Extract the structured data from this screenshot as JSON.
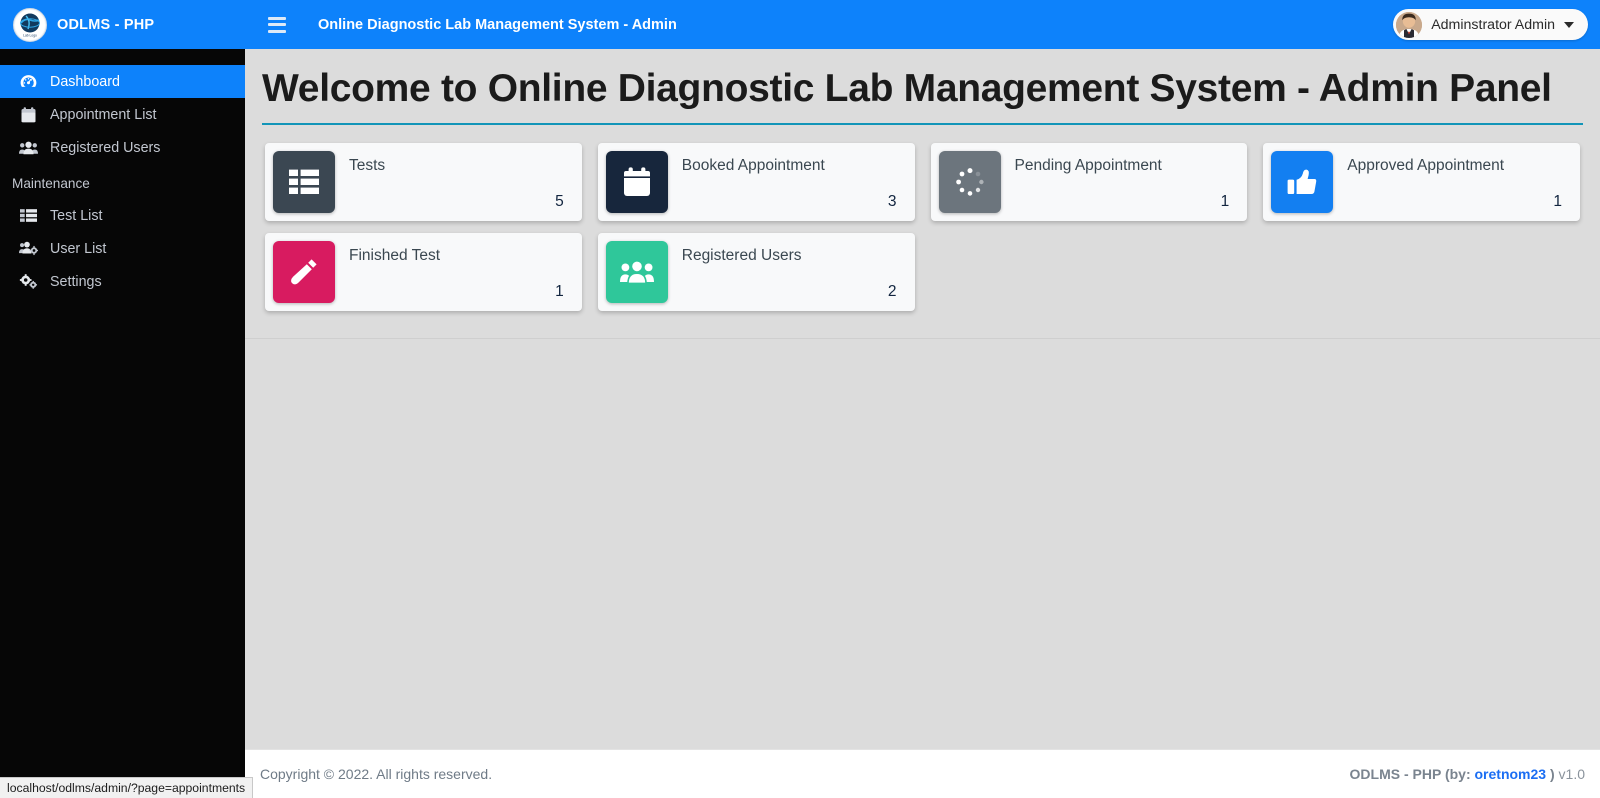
{
  "brand": {
    "title": "ODLMS - PHP",
    "logo_icon": "lab-globe-logo"
  },
  "topbar": {
    "menu_icon": "hamburger-icon",
    "title": "Online Diagnostic Lab Management System - Admin",
    "user_name": "Adminstrator Admin",
    "avatar_icon": "user-avatar",
    "caret_icon": "caret-down-icon",
    "bg_color": "#0d82fb"
  },
  "sidebar": {
    "items": [
      {
        "label": "Dashboard",
        "icon": "tachometer-dashboard-icon",
        "active": true
      },
      {
        "label": "Appointment List",
        "icon": "calendar-icon",
        "active": false
      },
      {
        "label": "Registered Users",
        "icon": "users-icon",
        "active": false
      }
    ],
    "section_header": "Maintenance",
    "maintenance_items": [
      {
        "label": "Test List",
        "icon": "th-list-icon",
        "active": false
      },
      {
        "label": "User List",
        "icon": "users-cog-icon",
        "active": false
      },
      {
        "label": "Settings",
        "icon": "cogs-icon",
        "active": false
      }
    ],
    "bg_color": "#060606",
    "active_color": "#0d82fb"
  },
  "main": {
    "page_title": "Welcome to Online Diagnostic Lab Management System - Admin Panel",
    "rule_color": "#1295b8",
    "cards": [
      {
        "label": "Tests",
        "value": "5",
        "icon": "th-list-icon",
        "color": "#3b4752"
      },
      {
        "label": "Booked Appointment",
        "value": "3",
        "icon": "calendar-icon",
        "color": "#17263c"
      },
      {
        "label": "Pending Appointment",
        "value": "1",
        "icon": "spinner-icon",
        "color": "#6c757d"
      },
      {
        "label": "Approved Appointment",
        "value": "1",
        "icon": "thumbs-up-icon",
        "color": "#137ff1"
      },
      {
        "label": "Finished Test",
        "value": "1",
        "icon": "vial-icon",
        "color": "#d81b60"
      },
      {
        "label": "Registered Users",
        "value": "2",
        "icon": "users-icon",
        "color": "#2fc79a"
      }
    ]
  },
  "footer": {
    "copyright": "Copyright © 2022. All rights reserved.",
    "credit_prefix": "ODLMS - PHP (by: ",
    "credit_link": "oretnom23",
    "credit_suffix": " )",
    "version": " v1.0"
  },
  "statusbar": {
    "url": "localhost/odlms/admin/?page=appointments"
  }
}
